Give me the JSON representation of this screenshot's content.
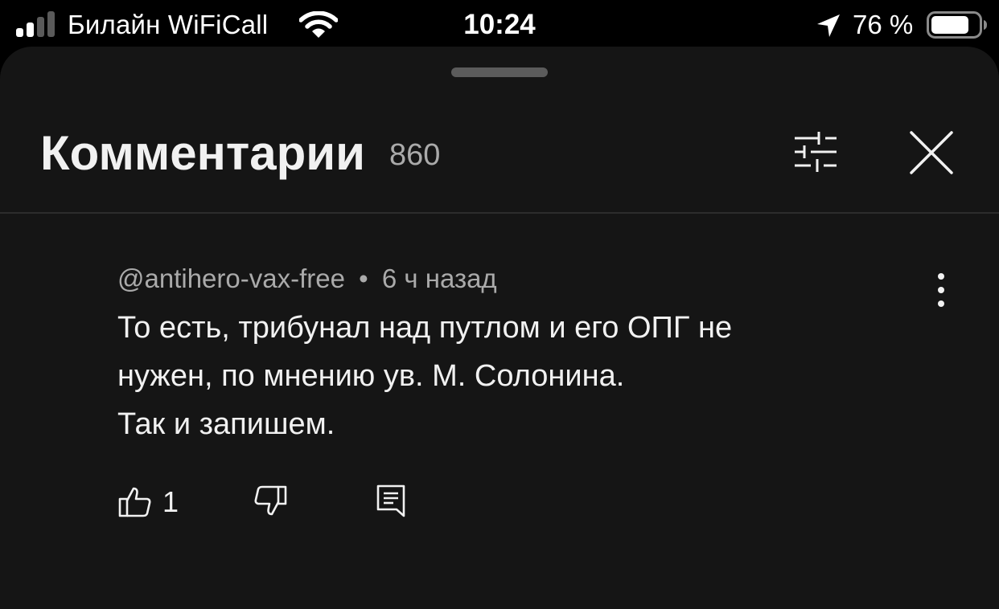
{
  "status_bar": {
    "carrier": "Билайн WiFiCall",
    "time": "10:24",
    "battery_percent": "76 %",
    "icons": [
      "signal-icon",
      "wifi-icon",
      "location-arrow-icon",
      "battery-icon"
    ]
  },
  "header": {
    "title": "Комментарии",
    "count": "860",
    "icons": [
      "filter-icon",
      "close-icon"
    ]
  },
  "comment": {
    "author": "@antihero-vax-free",
    "separator": "•",
    "time_ago": "6 ч назад",
    "lines": [
      "То есть, трибунал над путлом и его ОПГ не",
      "нужен, по мнению ув. М. Солонина.",
      "Так и запишем."
    ],
    "likes": "1",
    "icons": [
      "more-vertical-icon",
      "thumbs-up-icon",
      "thumbs-down-icon",
      "reply-icon"
    ]
  },
  "colors": {
    "background": "#000000",
    "sheet": "#151515",
    "text_primary": "#f1f1f1",
    "text_secondary": "#aaaaaa",
    "divider": "#2c2c2c"
  }
}
